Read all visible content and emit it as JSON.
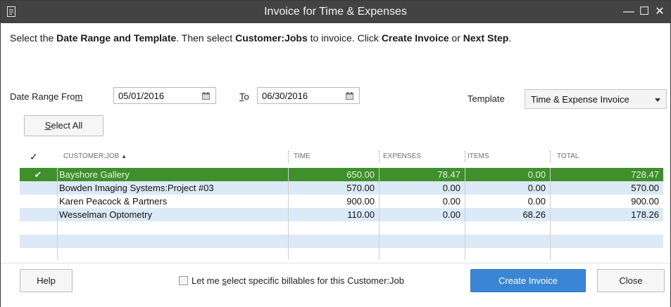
{
  "window": {
    "title": "Invoice for Time & Expenses",
    "controls": {
      "minimize": "—",
      "maximize": "☐",
      "close": "✕"
    }
  },
  "instructions": {
    "p1": "Select the ",
    "b1": "Date Range and Template",
    "p2": ". Then select ",
    "b2": "Customer:Jobs",
    "p3": " to invoice. Click ",
    "b3": "Create Invoice",
    "p4": " or ",
    "b4": "Next Step",
    "p5": "."
  },
  "date_range": {
    "from_label_pre": "Date Range Fro",
    "from_label_u": "m",
    "from_value": "05/01/2016",
    "to_label_u": "T",
    "to_label_post": "o",
    "to_value": "06/30/2016"
  },
  "template": {
    "label": "Template",
    "value": "Time & Expense Invoice"
  },
  "select_all": {
    "u": "S",
    "rest": "elect All"
  },
  "grid": {
    "check_header": "✓",
    "columns": {
      "customer": "CUSTOMER:JOB",
      "sort_indicator": "▲",
      "time": "TIME",
      "expenses": "EXPENSES",
      "items": "ITEMS",
      "total": "TOTAL"
    },
    "rows": [
      {
        "check": "✔",
        "customer": "Bayshore Gallery",
        "time": "650.00",
        "expenses": "78.47",
        "items": "0.00",
        "total": "728.47"
      },
      {
        "check": "",
        "customer": "Bowden Imaging Systems:Project #03",
        "time": "570.00",
        "expenses": "0.00",
        "items": "0.00",
        "total": "570.00"
      },
      {
        "check": "",
        "customer": "Karen Peacock & Partners",
        "time": "900.00",
        "expenses": "0.00",
        "items": "0.00",
        "total": "900.00"
      },
      {
        "check": "",
        "customer": "Wesselman Optometry",
        "time": "110.00",
        "expenses": "0.00",
        "items": "68.26",
        "total": "178.26"
      },
      {
        "check": "",
        "customer": "",
        "time": "",
        "expenses": "",
        "items": "",
        "total": ""
      },
      {
        "check": "",
        "customer": "",
        "time": "",
        "expenses": "",
        "items": "",
        "total": ""
      }
    ]
  },
  "footer": {
    "help": "Help",
    "let_me_pre": "Let me ",
    "let_me_u": "s",
    "let_me_post": "elect specific billables for this Customer:Job",
    "create_invoice": "Create Invoice",
    "close": "Close"
  },
  "colors": {
    "titlebar": "#434343",
    "selected_row": "#3f8f2c",
    "alt_row": "#dce9f6",
    "primary_button": "#3b86d4"
  }
}
